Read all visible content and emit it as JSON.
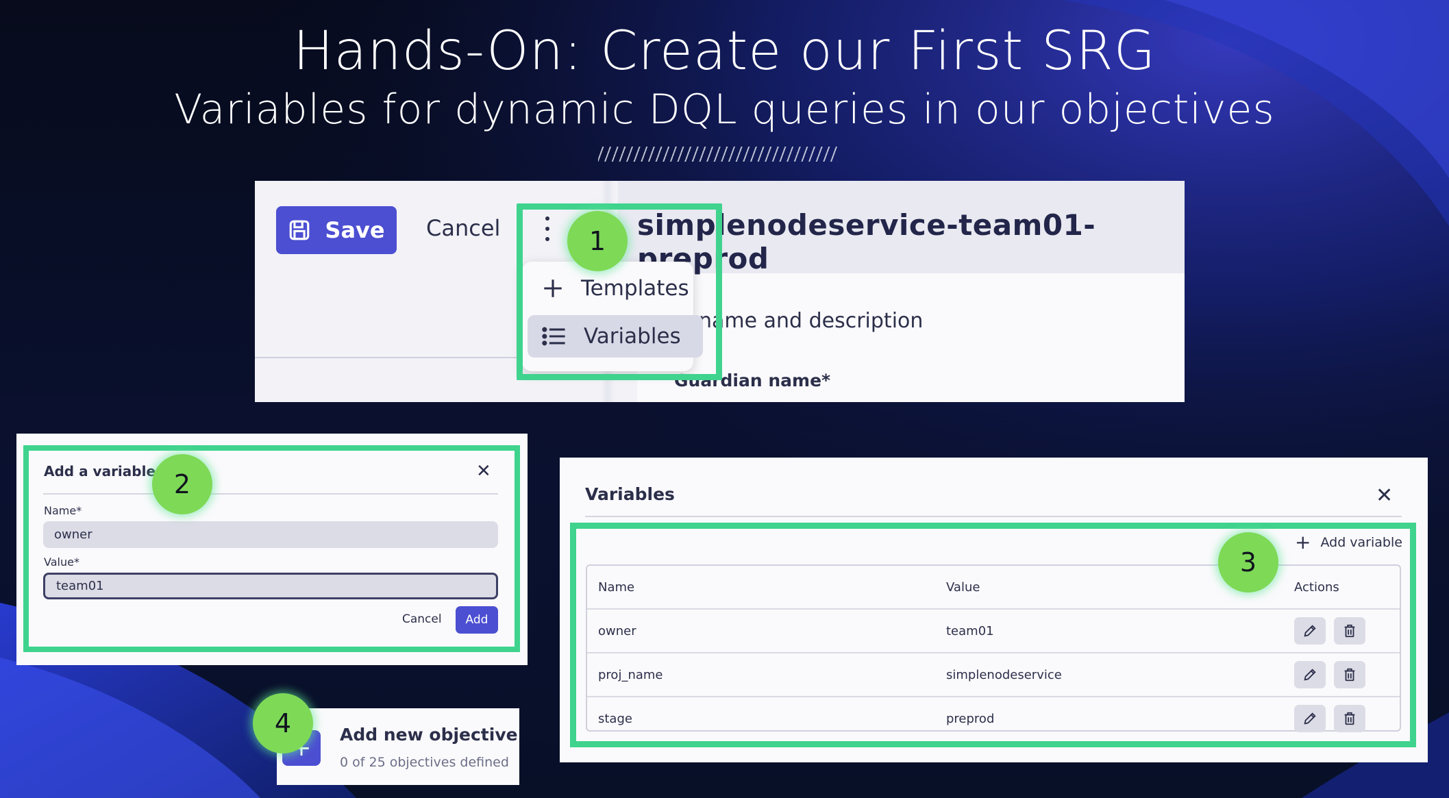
{
  "slide": {
    "title": "Hands-On: Create our First SRG",
    "subtitle": "Variables for dynamic DQL queries in our objectives"
  },
  "guardian_editor": {
    "save_label": "Save",
    "cancel_label": "Cancel",
    "service_name": "simplenodeservice-team01-preprod",
    "section_heading": "name and description",
    "field_label": "Guardian name*",
    "menu": {
      "items": [
        {
          "label": "Templates",
          "icon": "plus-icon"
        },
        {
          "label": "Variables",
          "icon": "list-icon",
          "selected": true
        }
      ]
    }
  },
  "add_variable_dialog": {
    "title": "Add a variable",
    "name_label": "Name*",
    "name_value": "owner",
    "value_label": "Value*",
    "value_value": "team01",
    "cancel_label": "Cancel",
    "add_label": "Add"
  },
  "variables_dialog": {
    "title": "Variables",
    "add_variable_label": "Add variable",
    "columns": [
      "Name",
      "Value",
      "Actions"
    ],
    "rows": [
      {
        "name": "owner",
        "value": "team01"
      },
      {
        "name": "proj_name",
        "value": "simplenodeservice"
      },
      {
        "name": "stage",
        "value": "preprod"
      }
    ]
  },
  "objectives": {
    "title": "Add new objective",
    "subtitle": "0 of 25 objectives defined"
  },
  "step_badges": [
    "1",
    "2",
    "3",
    "4"
  ],
  "colors": {
    "accent": "#4c4fd1",
    "highlight": "#3fd38e",
    "badge": "#7ed957",
    "background": "#070c1f"
  }
}
